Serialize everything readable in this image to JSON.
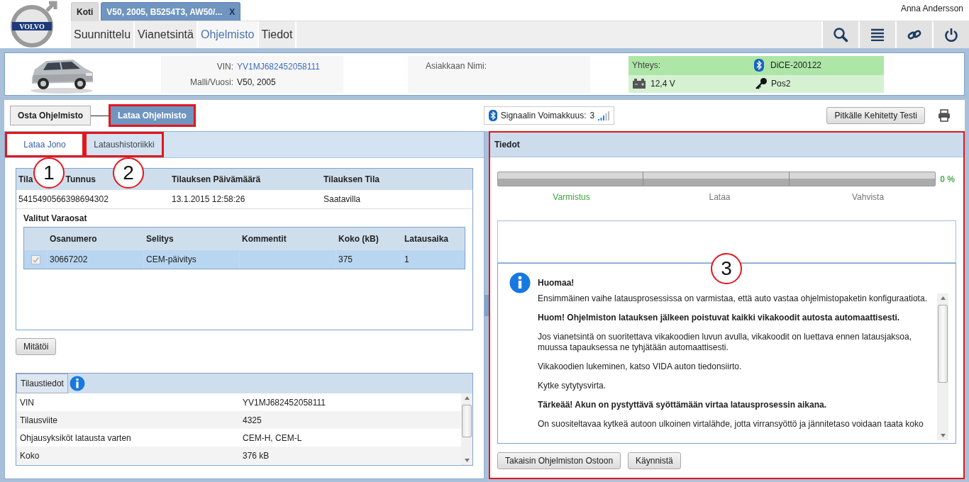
{
  "logo": {
    "text": "VOLVO"
  },
  "top_tabs": [
    {
      "label": "Koti",
      "selected": false
    },
    {
      "label": "V50, 2005, B5254T3, AW50/...",
      "selected": true,
      "close": "X"
    }
  ],
  "user": "Anna Andersson",
  "nav": [
    {
      "label": "Suunnittelu",
      "selected": false
    },
    {
      "label": "Vianetsintä",
      "selected": false
    },
    {
      "label": "Ohjelmisto",
      "selected": true
    },
    {
      "label": "Tiedot",
      "selected": false
    }
  ],
  "toolbar_icons": [
    {
      "kind": "search"
    },
    {
      "kind": "menu"
    },
    {
      "kind": "link"
    },
    {
      "kind": "power"
    }
  ],
  "vehicle": {
    "vin_label": "VIN:",
    "vin": "YV1MJ682452058111",
    "model_label": "Malli/Vuosi:",
    "model": "V50, 2005",
    "customer_label": "Asiakkaan Nimi:"
  },
  "connection": {
    "label": "Yhteys:",
    "device": "DiCE-200122",
    "voltage": "12,4 V",
    "ignition": "Pos2"
  },
  "workflow": [
    {
      "label": "Osta Ohjelmisto",
      "selected": false,
      "highlighted": false
    },
    {
      "label": "Lataa Ohjelmisto",
      "selected": true,
      "highlighted": true
    }
  ],
  "signal": {
    "label": "Signaalin Voimakkuus:",
    "value": "3"
  },
  "test_button": "Pitkälle Kehitetty Testi",
  "left_tabs": [
    {
      "label": "Lataa Jono",
      "selected": true,
      "highlighted": true,
      "callout": "1"
    },
    {
      "label": "Lataushistoriikki",
      "selected": false,
      "highlighted": true,
      "callout": "2"
    }
  ],
  "orders": {
    "columns": [
      {
        "parts": [
          "Tila",
          "Tunnus"
        ]
      },
      {
        "parts": [
          "Tilauksen Päivämäärä"
        ]
      },
      {
        "parts": [
          "Tilauksen Tila"
        ]
      }
    ],
    "rows": [
      [
        "5415490566398694302",
        "13.1.2015 12:58:26",
        "Saatavilla"
      ]
    ],
    "parts_title": "Valitut Varaosat",
    "parts_columns": [
      "Osanumero",
      "Selitys",
      "Kommentit",
      "Koko (kB)",
      "Latausaika"
    ],
    "parts_rows": [
      {
        "checked": true,
        "disabled": true,
        "selected": true,
        "part_number": "30667202",
        "description": "CEM-päivitys",
        "size": "375",
        "time": "1"
      }
    ]
  },
  "cancel_button": "Mitätöi",
  "order_info": {
    "title": "Tilaustiedot",
    "rows": [
      {
        "label": "VIN",
        "value": "YV1MJ682452058111"
      },
      {
        "label": "Tilausviite",
        "value": "4325"
      },
      {
        "label": "Ohjausyksiköt latausta varten",
        "value": "CEM-H, CEM-L"
      },
      {
        "label": "Koko",
        "value": "376 kB"
      }
    ]
  },
  "details": {
    "title": "Tiedot",
    "highlighted": true,
    "callout": "3",
    "progress": {
      "level": 0,
      "reading": "0 %",
      "steps": [
        {
          "label": "Varmistus",
          "active": true
        },
        {
          "label": "Lataa",
          "active": false
        },
        {
          "label": "Vahvista",
          "active": false
        }
      ]
    },
    "note": {
      "title": "Huomaa!",
      "paragraphs": [
        {
          "text": "Ensimmäinen vaihe latausprosessissa on varmistaa, että auto vastaa ohjelmistopaketin konfiguraatiota.",
          "bold": false
        },
        {
          "text": "Huom! Ohjelmiston latauksen jälkeen poistuvat kaikki vikakoodit autosta automaattisesti.",
          "bold": true
        },
        {
          "text": "Jos vianetsintä on suoritettava vikakoodien luvun avulla, vikakoodit on luettava ennen latausjaksoa, muussa tapauksessa ne tyhjätään automaattisesti.",
          "bold": false
        },
        {
          "text": "Vikakoodien lukeminen, katso VIDA auton tiedonsiirto.",
          "bold": false
        },
        {
          "text": "Kytke sytytysvirta.",
          "bold": false
        },
        {
          "text": "Tärkeää! Akun on pystyttävä syöttämään virtaa latausprosessin aikana.",
          "bold": true
        },
        {
          "text": "On suositeltavaa kytkeä autoon ulkoinen virtalähde, jotta virransyöttö ja jännitetaso voidaan taata koko",
          "bold": false
        }
      ]
    },
    "buttons": [
      "Takaisin Ohjelmiston Ostoon",
      "Käynnistä"
    ]
  }
}
